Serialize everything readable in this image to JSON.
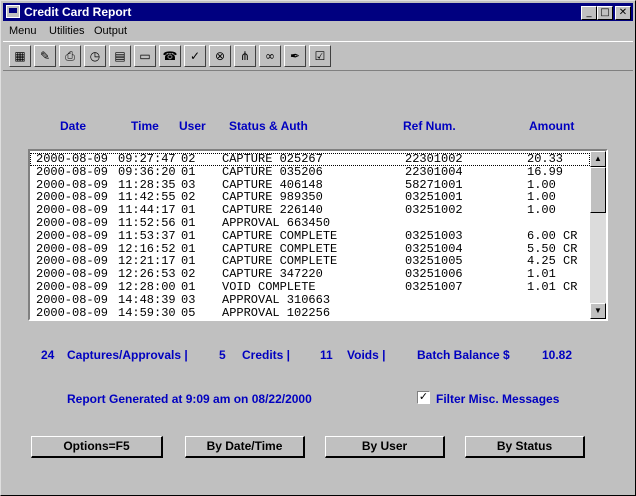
{
  "window": {
    "title": "Credit Card Report"
  },
  "title_buttons": {
    "minimize": "_",
    "maximize": "□",
    "close": "✕"
  },
  "menu": [
    {
      "label": "Menu"
    },
    {
      "label": "Utilities"
    },
    {
      "label": "Output"
    }
  ],
  "toolbar": [
    {
      "icon": "calculator-icon",
      "glyph": "▦"
    },
    {
      "icon": "notepad-icon",
      "glyph": "✎"
    },
    {
      "icon": "printer-icon",
      "glyph": "⎙"
    },
    {
      "icon": "clock-icon",
      "glyph": "◷"
    },
    {
      "icon": "report-icon",
      "glyph": "▤"
    },
    {
      "icon": "card-reader-icon",
      "glyph": "▭"
    },
    {
      "icon": "phone-icon",
      "glyph": "☎"
    },
    {
      "icon": "stk-check-icon",
      "glyph": "✓"
    },
    {
      "icon": "binoculars-icon",
      "glyph": "⊗"
    },
    {
      "icon": "network-icon",
      "glyph": "⋔"
    },
    {
      "icon": "glasses-icon",
      "glyph": "∞"
    },
    {
      "icon": "pen-icon",
      "glyph": "✒"
    },
    {
      "icon": "settings-icon",
      "glyph": "☑"
    }
  ],
  "headers": {
    "date": "Date",
    "time": "Time",
    "user": "User",
    "status": "Status & Auth",
    "ref": "Ref Num.",
    "amount": "Amount"
  },
  "rows": [
    {
      "date": "2000-08-09",
      "time": "09:27:47",
      "user": "02",
      "status": "CAPTURE 025267",
      "ref": "22301002",
      "amount": "20.33"
    },
    {
      "date": "2000-08-09",
      "time": "09:36:20",
      "user": "01",
      "status": "CAPTURE 035206",
      "ref": "22301004",
      "amount": "16.99"
    },
    {
      "date": "2000-08-09",
      "time": "11:28:35",
      "user": "03",
      "status": "CAPTURE 406148",
      "ref": "58271001",
      "amount": "1.00"
    },
    {
      "date": "2000-08-09",
      "time": "11:42:55",
      "user": "02",
      "status": "CAPTURE 989350",
      "ref": "03251001",
      "amount": "1.00"
    },
    {
      "date": "2000-08-09",
      "time": "11:44:17",
      "user": "01",
      "status": "CAPTURE 226140",
      "ref": "03251002",
      "amount": "1.00"
    },
    {
      "date": "2000-08-09",
      "time": "11:52:56",
      "user": "01",
      "status": "APPROVAL 663450",
      "ref": "",
      "amount": ""
    },
    {
      "date": "2000-08-09",
      "time": "11:53:37",
      "user": "01",
      "status": "CAPTURE COMPLETE",
      "ref": "03251003",
      "amount": "6.00 CR"
    },
    {
      "date": "2000-08-09",
      "time": "12:16:52",
      "user": "01",
      "status": "CAPTURE COMPLETE",
      "ref": "03251004",
      "amount": "5.50 CR"
    },
    {
      "date": "2000-08-09",
      "time": "12:21:17",
      "user": "01",
      "status": "CAPTURE COMPLETE",
      "ref": "03251005",
      "amount": "4.25 CR"
    },
    {
      "date": "2000-08-09",
      "time": "12:26:53",
      "user": "02",
      "status": "CAPTURE 347220",
      "ref": "03251006",
      "amount": "1.01"
    },
    {
      "date": "2000-08-09",
      "time": "12:28:00",
      "user": "01",
      "status": "VOID COMPLETE",
      "ref": "03251007",
      "amount": "1.01 CR"
    },
    {
      "date": "2000-08-09",
      "time": "14:48:39",
      "user": "03",
      "status": "APPROVAL 310663",
      "ref": "",
      "amount": ""
    },
    {
      "date": "2000-08-09",
      "time": "14:59:30",
      "user": "05",
      "status": "APPROVAL 102256",
      "ref": "",
      "amount": ""
    }
  ],
  "summary": {
    "captures_count": "24",
    "captures_label": "Captures/Approvals |",
    "credits_count": "5",
    "credits_label": "Credits |",
    "voids_count": "11",
    "voids_label": "Voids |",
    "balance_label": "Batch Balance $",
    "balance_value": "10.82"
  },
  "report_generated": "Report Generated at  9:09 am on 08/22/2000",
  "filter": {
    "label": "Filter Misc. Messages",
    "checked": true,
    "mark": "✓"
  },
  "buttons": {
    "options": "Options=F5",
    "by_date": "By Date/Time",
    "by_user": "By User",
    "by_status": "By Status"
  }
}
